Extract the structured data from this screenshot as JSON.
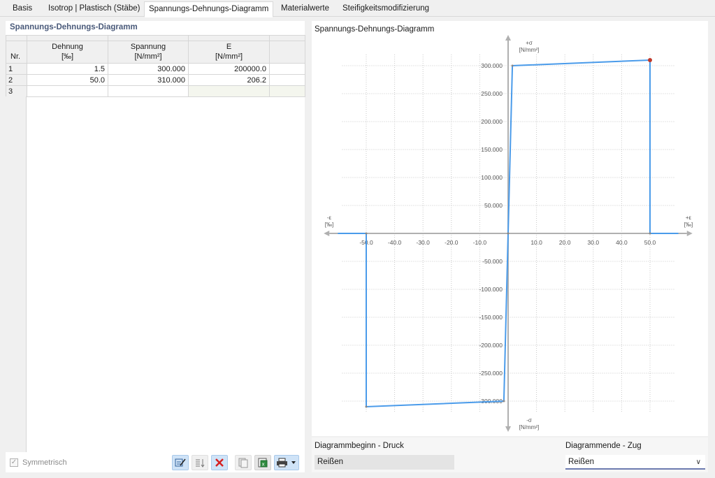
{
  "tabs": [
    {
      "label": "Basis",
      "active": false
    },
    {
      "label": "Isotrop | Plastisch (Stäbe)",
      "active": false
    },
    {
      "label": "Spannungs-Dehnungs-Diagramm",
      "active": true
    },
    {
      "label": "Materialwerte",
      "active": false
    },
    {
      "label": "Steifigkeitsmodifizierung",
      "active": false
    }
  ],
  "table": {
    "title": "Spannungs-Dehnungs-Diagramm",
    "headers": {
      "nr": "Nr.",
      "dehnung": "Dehnung",
      "dehnung_unit": "[‰]",
      "spannung": "Spannung",
      "spannung_unit": "[N/mm²]",
      "e": "E",
      "e_unit": "[N/mm²]"
    },
    "rows": [
      {
        "nr": "1",
        "dehnung": "1.5",
        "spannung": "300.000",
        "e": "200000.0"
      },
      {
        "nr": "2",
        "dehnung": "50.0",
        "spannung": "310.000",
        "e": "206.2"
      },
      {
        "nr": "3",
        "dehnung": "",
        "spannung": "",
        "e": ""
      }
    ]
  },
  "symmetrisch": {
    "label": "Symmetrisch",
    "checked": true,
    "disabled": true
  },
  "toolbar": {
    "icons": [
      "edit-table-icon",
      "sort-icon",
      "delete-icon",
      "copy-icon",
      "export-excel-icon",
      "print-icon"
    ]
  },
  "chart": {
    "title": "Spannungs-Dehnungs-Diagramm",
    "x_pos_label": "+ε",
    "x_neg_label": "-ε",
    "x_unit": "[‰]",
    "y_pos_label": "+σ",
    "y_neg_label": "-σ",
    "y_unit": "[N/mm²]",
    "line_color": "#4a9bea",
    "marker_color": "#c0392b"
  },
  "chart_data": {
    "type": "line",
    "title": "Spannungs-Dehnungs-Diagramm",
    "xlabel": "ε [‰]",
    "ylabel": "σ [N/mm²]",
    "xlim": [
      -50,
      50
    ],
    "ylim": [
      -300,
      300
    ],
    "x_ticks": [
      "-50.0",
      "-40.0",
      "-30.0",
      "-20.0",
      "-10.0",
      "10.0",
      "20.0",
      "30.0",
      "40.0",
      "50.0"
    ],
    "y_ticks": [
      "300.000",
      "250.000",
      "200.000",
      "150.000",
      "100.000",
      "50.000",
      "-50.000",
      "-100.000",
      "-150.000",
      "-200.000",
      "-250.000",
      "-300.000"
    ],
    "x_tick_values": [
      -50,
      -40,
      -30,
      -20,
      -10,
      10,
      20,
      30,
      40,
      50
    ],
    "y_tick_values": [
      300,
      250,
      200,
      150,
      100,
      50,
      -50,
      -100,
      -150,
      -200,
      -250,
      -300
    ],
    "grid": true,
    "series": [
      {
        "x": [
          -60,
          -50,
          -50,
          -1.5,
          0,
          1.5,
          50,
          50,
          60
        ],
        "y": [
          0,
          0,
          -310,
          -300,
          0,
          300,
          310,
          0,
          0
        ]
      }
    ],
    "highlight_point": {
      "x": 50,
      "y": 310
    }
  },
  "bottom": {
    "begin_label": "Diagrammbeginn - Druck",
    "begin_value": "Reißen",
    "end_label": "Diagrammende - Zug",
    "end_value": "Reißen"
  }
}
